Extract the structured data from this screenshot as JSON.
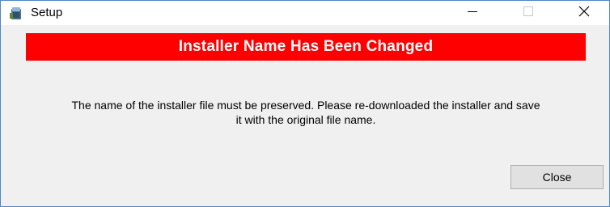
{
  "window": {
    "title": "Setup",
    "app_icon": "setup-icon",
    "controls": {
      "minimize_icon": "minimize-icon",
      "maximize_icon": "maximize-icon",
      "close_icon": "close-icon"
    }
  },
  "banner": {
    "text": "Installer Name Has Been Changed",
    "background": "#ff0000",
    "color": "#ffffff"
  },
  "message": {
    "line1": "The name of the installer file must be preserved.  Please re-downloaded the installer and save",
    "line2": "it with the original file name."
  },
  "buttons": {
    "close_label": "Close"
  }
}
